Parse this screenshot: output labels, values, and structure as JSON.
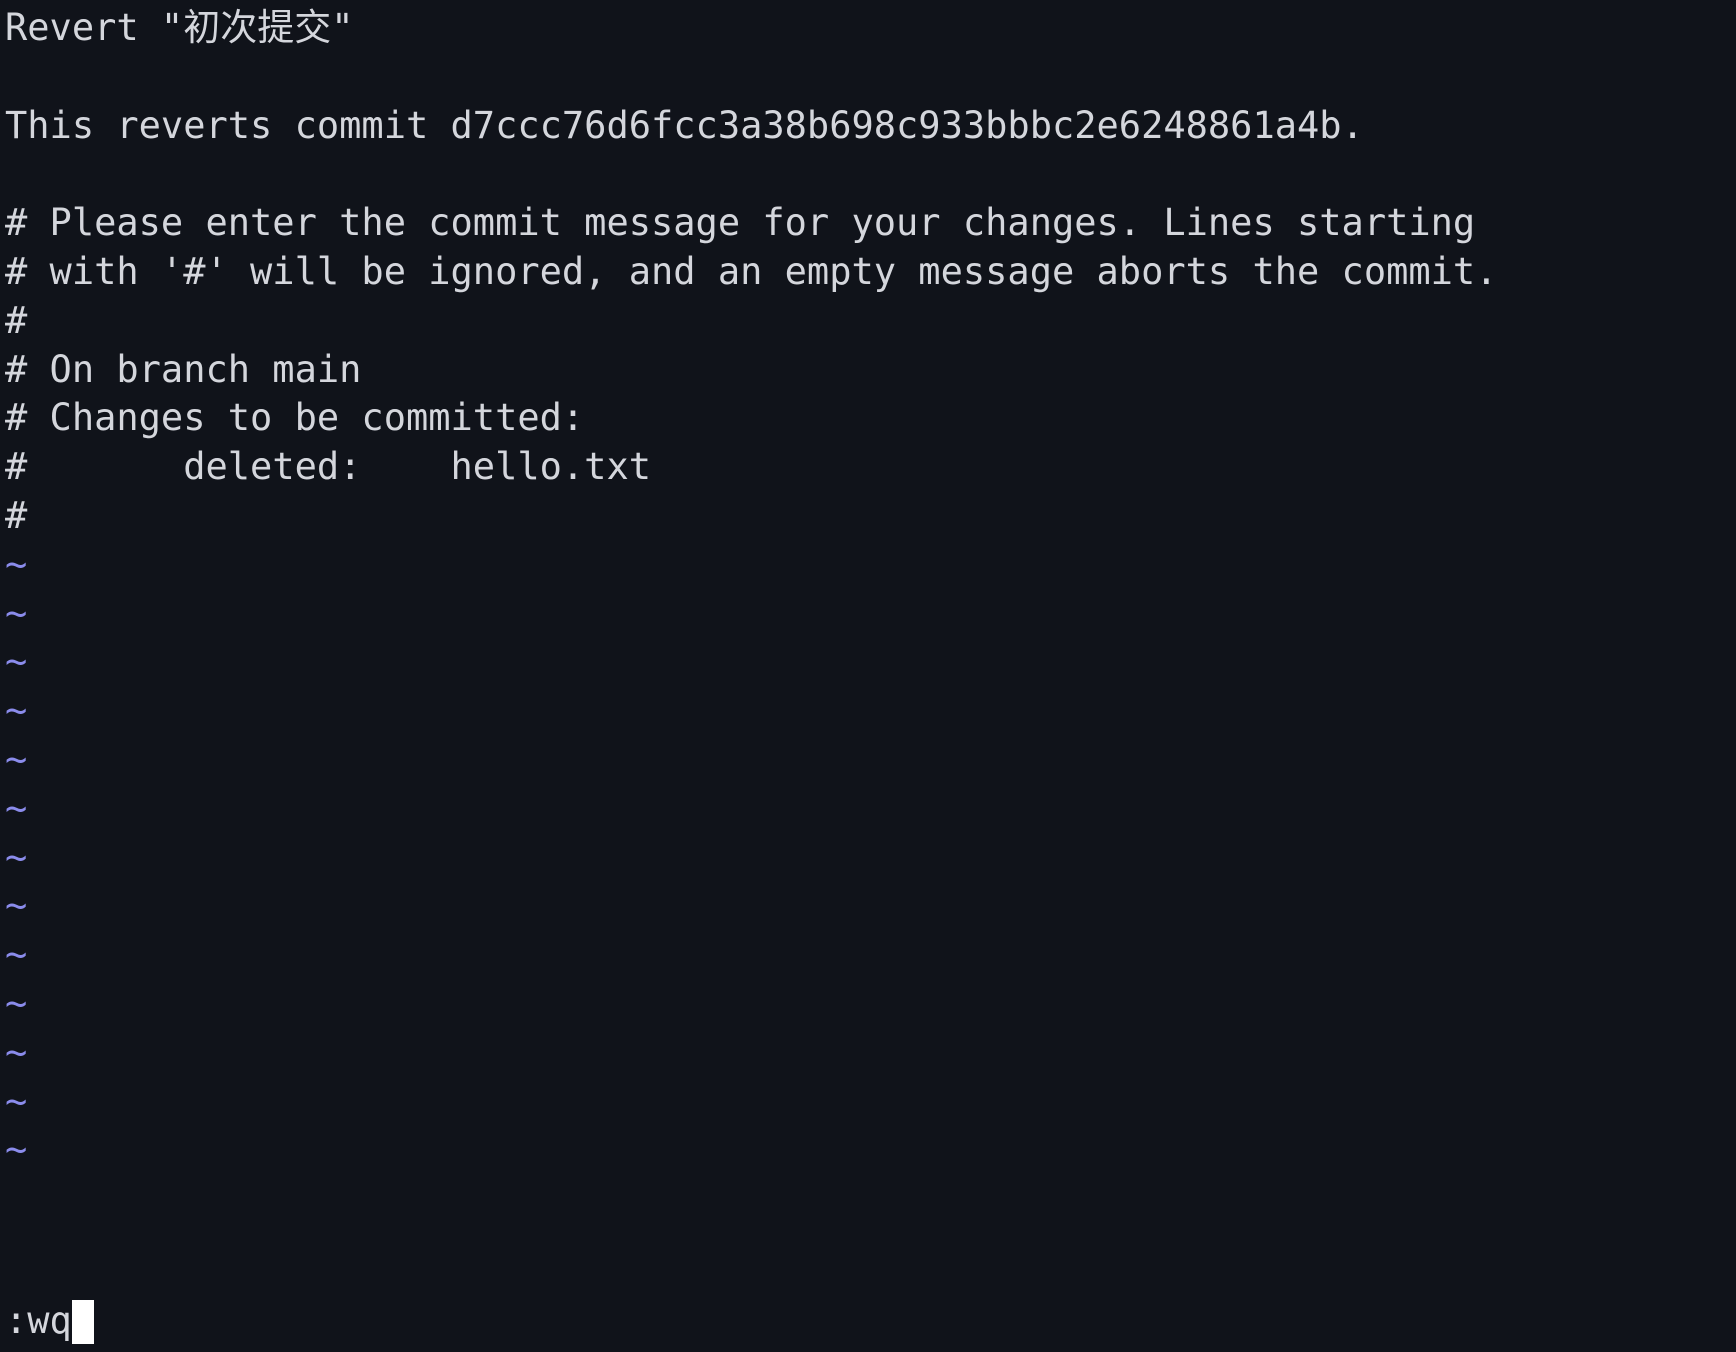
{
  "editor": {
    "name": "vim",
    "mode": "command",
    "background_color": "#10131a",
    "text_color": "#d4d6dc",
    "tilde_color": "#8b8cec",
    "cursor_color": "#ffffff"
  },
  "buffer": {
    "lines": [
      "Revert \"初次提交\"",
      "",
      "This reverts commit d7ccc76d6fcc3a38b698c933bbbc2e6248861a4b.",
      "",
      "# Please enter the commit message for your changes. Lines starting",
      "# with '#' will be ignored, and an empty message aborts the commit.",
      "#",
      "# On branch main",
      "# Changes to be committed:",
      "#\tdeleted:    hello.txt",
      "#"
    ],
    "filler_rows": [
      "~",
      "~",
      "~",
      "~",
      "~",
      "~",
      "~",
      "~",
      "~",
      "~",
      "~",
      "~",
      "~"
    ]
  },
  "commit": {
    "subject": "Revert \"初次提交\"",
    "reverted_hash": "d7ccc76d6fcc3a38b698c933bbbc2e6248861a4b",
    "branch": "main",
    "staged_changes": [
      {
        "status": "deleted:",
        "path": "hello.txt"
      }
    ]
  },
  "command_line": {
    "text": ":wq",
    "cursor": "block"
  }
}
